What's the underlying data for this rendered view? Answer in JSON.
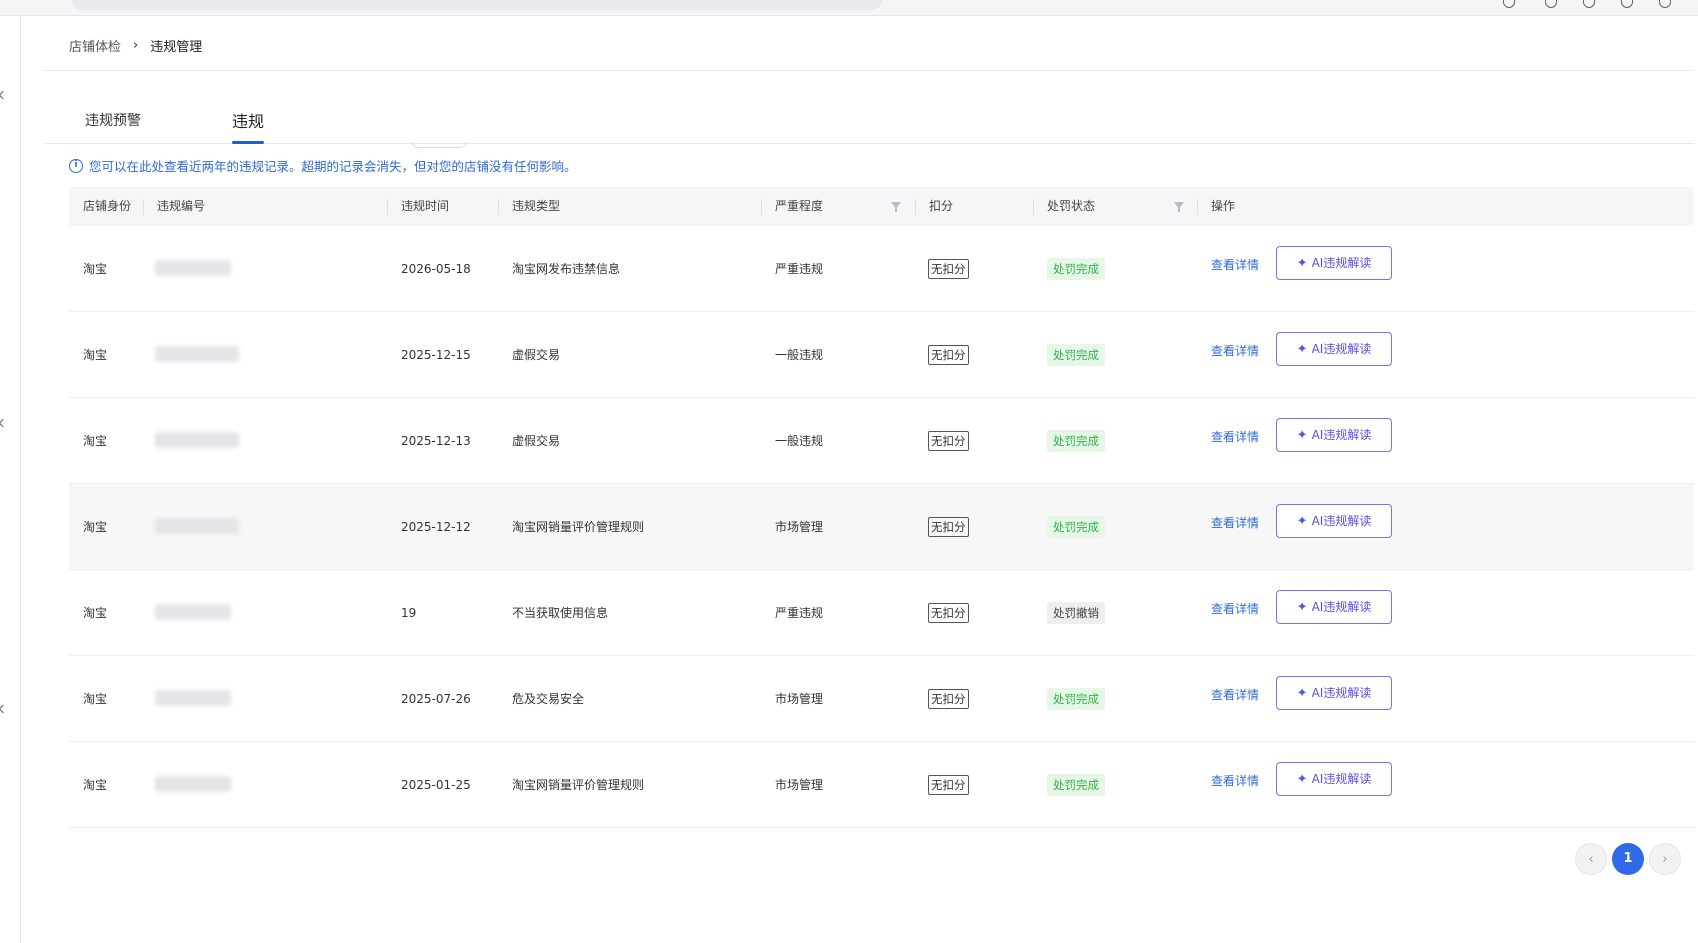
{
  "breadcrumb": {
    "parent": "店铺体检",
    "separator": "›",
    "current": "违规管理"
  },
  "tabs": [
    {
      "label": "违规预警"
    },
    {
      "label": "违规"
    }
  ],
  "notice": {
    "icon": "info-icon",
    "text": "您可以在此处查看近两年的违规记录。超期的记录会消失，但对您的店铺没有任何影响。"
  },
  "table": {
    "headers": {
      "identity": "店铺身份",
      "number": "违规编号",
      "time": "违规时间",
      "type": "违规类型",
      "severity": "严重程度",
      "deduction": "扣分",
      "status": "处罚状态",
      "action": "操作"
    },
    "rows": [
      {
        "identity": "淘宝",
        "time": "2026-05-18",
        "type": "淘宝网发布违禁信息",
        "severity": "严重违规",
        "deduction": "无扣分",
        "status": "处罚完成",
        "status_kind": "ok",
        "detail": "查看详情",
        "ai": "AI违规解读"
      },
      {
        "identity": "淘宝",
        "time": "2025-12-15",
        "type": "虚假交易",
        "severity": "一般违规",
        "deduction": "无扣分",
        "status": "处罚完成",
        "status_kind": "ok",
        "detail": "查看详情",
        "ai": "AI违规解读"
      },
      {
        "identity": "淘宝",
        "time": "2025-12-13",
        "type": "虚假交易",
        "severity": "一般违规",
        "deduction": "无扣分",
        "status": "处罚完成",
        "status_kind": "ok",
        "detail": "查看详情",
        "ai": "AI违规解读"
      },
      {
        "identity": "淘宝",
        "time": "2025-12-12",
        "type": "淘宝网销量评价管理规则",
        "severity": "市场管理",
        "deduction": "无扣分",
        "status": "处罚完成",
        "status_kind": "ok",
        "detail": "查看详情",
        "ai": "AI违规解读"
      },
      {
        "identity": "淘宝",
        "time": "19",
        "type": "不当获取使用信息",
        "severity": "严重违规",
        "deduction": "无扣分",
        "status": "处罚撤销",
        "status_kind": "cancel",
        "detail": "查看详情",
        "ai": "AI违规解读"
      },
      {
        "identity": "淘宝",
        "time": "2025-07-26",
        "type": "危及交易安全",
        "severity": "市场管理",
        "deduction": "无扣分",
        "status": "处罚完成",
        "status_kind": "ok",
        "detail": "查看详情",
        "ai": "AI违规解读"
      },
      {
        "identity": "淘宝",
        "time": "2025-01-25",
        "type": "淘宝网销量评价管理规则",
        "severity": "市场管理",
        "deduction": "无扣分",
        "status": "处罚完成",
        "status_kind": "ok",
        "detail": "查看详情",
        "ai": "AI违规解读"
      }
    ]
  },
  "pagination": {
    "prev": "‹",
    "current": "1",
    "next": "›"
  },
  "icons": {
    "filter": "filter-icon",
    "sparkle": "sparkle-icon",
    "chevron_right": "chevron-right-icon"
  },
  "colors": {
    "primary": "#2f6ad9",
    "success": "#2fb34a",
    "ai_border": "#6f74f0"
  }
}
